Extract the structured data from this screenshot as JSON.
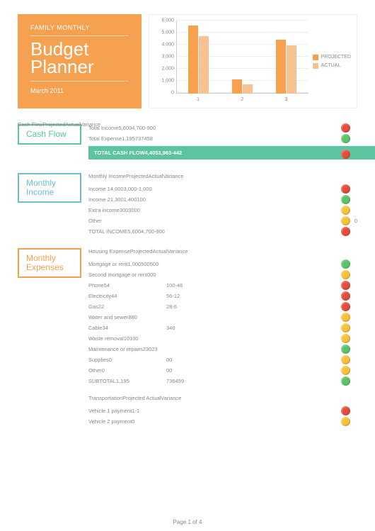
{
  "title_box": {
    "subtitle": "FAMILY MONTHLY",
    "title": "Budget Planner",
    "date": "March 2011"
  },
  "chart_data": {
    "type": "bar",
    "categories": [
      "1",
      "2",
      "3"
    ],
    "series": [
      {
        "name": "PROJECTED",
        "values": [
          5600,
          1195,
          4400
        ],
        "color": "#f5a14f"
      },
      {
        "name": "ACTUAL",
        "values": [
          4700,
          737,
          3963
        ],
        "color": "#f7c191"
      }
    ],
    "ylim": [
      0,
      6000
    ],
    "yticks": [
      0,
      1000,
      2000,
      3000,
      4000,
      5000,
      6000
    ],
    "legend_position": "right"
  },
  "cash_flow": {
    "header": "Cash FlowProjectedActualVariance",
    "label": "Cash Flow",
    "rows": [
      {
        "text": "Total Income5,6004,700-900",
        "indicator": "red"
      },
      {
        "text": "Total Expense1,195737458",
        "indicator": "green"
      }
    ],
    "total": {
      "text": "TOTAL CASH FLOW4,4053,963-442",
      "indicator": "red"
    }
  },
  "monthly_income": {
    "label": "Monthly Income",
    "header": "Monthly IncomeProjectedActualVariance",
    "rows": [
      {
        "text": "Income 14,0003,000-1,000",
        "indicator": "red"
      },
      {
        "text": "Income 21,3001,400100",
        "indicator": "green"
      },
      {
        "text": "Extra income3003000",
        "indicator": "yellow"
      },
      {
        "text": "Other",
        "indicator": "yellow",
        "right_val": "0"
      },
      {
        "text": "TOTAL INCOME5,6004,700-900",
        "indicator": "red"
      }
    ]
  },
  "monthly_expenses": {
    "label": "Monthly Expenses",
    "housing": {
      "header": "Housing ExpenseProjectedActualVariance",
      "rows": [
        {
          "label": "Mortgage or rent",
          "vals": "1,000500500",
          "indicator": "green"
        },
        {
          "label": "Second mortgage or rent",
          "vals": "000",
          "indicator": "yellow"
        },
        {
          "label": "Phone",
          "vals": "54",
          "vals2": "100-46",
          "indicator": "red"
        },
        {
          "label": "Electricity",
          "vals": "44",
          "vals2": "56-12",
          "indicator": "red"
        },
        {
          "label": "Gas",
          "vals": "22",
          "vals2": "28-6",
          "indicator": "red"
        },
        {
          "label": "Water and sewer",
          "vals": "880",
          "indicator": "yellow"
        },
        {
          "label": "Cable",
          "vals": "34",
          "vals2": "340",
          "indicator": "yellow"
        },
        {
          "label": "Waste removal",
          "vals": "10100",
          "indicator": "yellow"
        },
        {
          "label": "Maintenance or repairs",
          "vals": "23023",
          "indicator": "green"
        },
        {
          "label": "Supplies",
          "vals": "0",
          "vals2": "00",
          "indicator": "yellow"
        },
        {
          "label": "Other",
          "vals": "0",
          "vals2": "00",
          "indicator": "yellow"
        },
        {
          "label": "SUBTOTAL",
          "vals": "1,195",
          "vals2": "736459",
          "indicator": "green"
        }
      ]
    },
    "transportation": {
      "header": "TransportationProjected            ActualVariance",
      "rows": [
        {
          "label": "Vehicle 1 payment",
          "vals": "1-1",
          "indicator": "red"
        },
        {
          "label": "Vehicle 2 payment",
          "vals": "0",
          "indicator": "yellow"
        }
      ]
    }
  },
  "footer": "Page 1 of 4"
}
